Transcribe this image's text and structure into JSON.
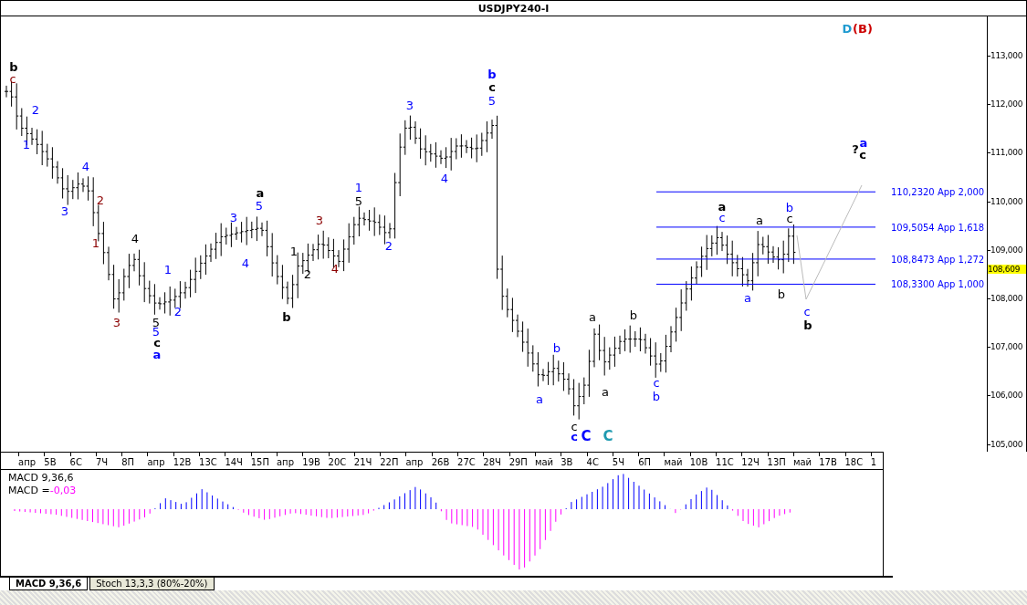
{
  "chart": {
    "title": "USDJPY240-I",
    "price_axis": [
      "113,000",
      "112,000",
      "111,000",
      "110,000",
      "109,000",
      "108,000",
      "107,000",
      "106,000",
      "105,000"
    ],
    "current_price": "108,609",
    "date_axis": [
      "апр",
      "5В",
      "6С",
      "7Ч",
      "8П",
      "апр",
      "12В",
      "13С",
      "14Ч",
      "15П",
      "апр",
      "19В",
      "20С",
      "21Ч",
      "22П",
      "апр",
      "26В",
      "27С",
      "28Ч",
      "29П",
      "май",
      "3В",
      "4С",
      "5Ч",
      "6П",
      "май",
      "10В",
      "11С",
      "12Ч",
      "13П",
      "май",
      "17В",
      "18С",
      "1"
    ],
    "fib_levels": [
      {
        "label": "110,2320 App 2,000"
      },
      {
        "label": "109,5054 App 1,618"
      },
      {
        "label": "108,8473 App 1,272"
      },
      {
        "label": "108,3300 App 1,000"
      }
    ],
    "wave_labels": [
      {
        "text": "b",
        "color": "#000000",
        "bold": true
      },
      {
        "text": "c",
        "color": "#8b0000",
        "bold": false
      },
      {
        "text": "2",
        "color": "#0000ff",
        "bold": false
      },
      {
        "text": "1",
        "color": "#0000ff",
        "bold": false
      },
      {
        "text": "4",
        "color": "#0000ff",
        "bold": false
      },
      {
        "text": "3",
        "color": "#0000ff",
        "bold": false
      },
      {
        "text": "2",
        "color": "#8b0000",
        "bold": false
      },
      {
        "text": "1",
        "color": "#8b0000",
        "bold": false
      },
      {
        "text": "4",
        "color": "#000000",
        "bold": false
      },
      {
        "text": "3",
        "color": "#8b0000",
        "bold": false
      },
      {
        "text": "1",
        "color": "#0000ff",
        "bold": false
      },
      {
        "text": "5",
        "color": "#000000",
        "bold": false
      },
      {
        "text": "5",
        "color": "#0000ff",
        "bold": false
      },
      {
        "text": "c",
        "color": "#000000",
        "bold": true
      },
      {
        "text": "a",
        "color": "#0000ff",
        "bold": true
      },
      {
        "text": "2",
        "color": "#0000ff",
        "bold": false
      },
      {
        "text": "a",
        "color": "#000000",
        "bold": true
      },
      {
        "text": "5",
        "color": "#0000ff",
        "bold": false
      },
      {
        "text": "3",
        "color": "#0000ff",
        "bold": false
      },
      {
        "text": "4",
        "color": "#0000ff",
        "bold": false
      },
      {
        "text": "1",
        "color": "#000000",
        "bold": false
      },
      {
        "text": "2",
        "color": "#000000",
        "bold": false
      },
      {
        "text": "3",
        "color": "#8b0000",
        "bold": false
      },
      {
        "text": "4",
        "color": "#8b0000",
        "bold": false
      },
      {
        "text": "b",
        "color": "#000000",
        "bold": true
      },
      {
        "text": "1",
        "color": "#0000ff",
        "bold": false
      },
      {
        "text": "5",
        "color": "#000000",
        "bold": false
      },
      {
        "text": "2",
        "color": "#0000ff",
        "bold": false
      },
      {
        "text": "3",
        "color": "#0000ff",
        "bold": false
      },
      {
        "text": "4",
        "color": "#0000ff",
        "bold": false
      },
      {
        "text": "b",
        "color": "#0000ff",
        "bold": true
      },
      {
        "text": "c",
        "color": "#000000",
        "bold": true
      },
      {
        "text": "5",
        "color": "#0000ff",
        "bold": false
      },
      {
        "text": "b",
        "color": "#0000ff",
        "bold": false
      },
      {
        "text": "a",
        "color": "#0000ff",
        "bold": false
      },
      {
        "text": "c",
        "color": "#000000",
        "bold": false
      },
      {
        "text": "c",
        "color": "#0000ff",
        "bold": true
      },
      {
        "text": "C",
        "color": "#0000ff",
        "bold": true
      },
      {
        "text": "C",
        "color": "#1e9ab0",
        "bold": true
      },
      {
        "text": "a",
        "color": "#000000",
        "bold": false
      },
      {
        "text": "a",
        "color": "#000000",
        "bold": false
      },
      {
        "text": "b",
        "color": "#000000",
        "bold": false
      },
      {
        "text": "c",
        "color": "#0000ff",
        "bold": false
      },
      {
        "text": "b",
        "color": "#0000ff",
        "bold": false
      },
      {
        "text": "a",
        "color": "#000000",
        "bold": true
      },
      {
        "text": "c",
        "color": "#0000ff",
        "bold": false
      },
      {
        "text": "a",
        "color": "#0000ff",
        "bold": false
      },
      {
        "text": "a",
        "color": "#000000",
        "bold": false
      },
      {
        "text": "b",
        "color": "#0000ff",
        "bold": false
      },
      {
        "text": "c",
        "color": "#000000",
        "bold": false
      },
      {
        "text": "b",
        "color": "#000000",
        "bold": false
      },
      {
        "text": "c",
        "color": "#0000ff",
        "bold": false
      },
      {
        "text": "b",
        "color": "#000000",
        "bold": true
      },
      {
        "text": "?",
        "color": "#000000",
        "bold": true
      },
      {
        "text": "a",
        "color": "#0000ff",
        "bold": true
      },
      {
        "text": "c",
        "color": "#000000",
        "bold": true
      },
      {
        "text": "D",
        "color": "#1e9ad0",
        "bold": true
      },
      {
        "text": "(B)",
        "color": "#cc0000",
        "bold": true
      }
    ]
  },
  "indicator": {
    "name": "MACD 9,36,6",
    "reading_label": "MACD =",
    "reading_value": "-0,03"
  },
  "tabs": [
    {
      "label": "MACD 9,36,6",
      "selected": true
    },
    {
      "label": "Stoch 13,3,3 (80%-20%)",
      "selected": false
    }
  ]
}
